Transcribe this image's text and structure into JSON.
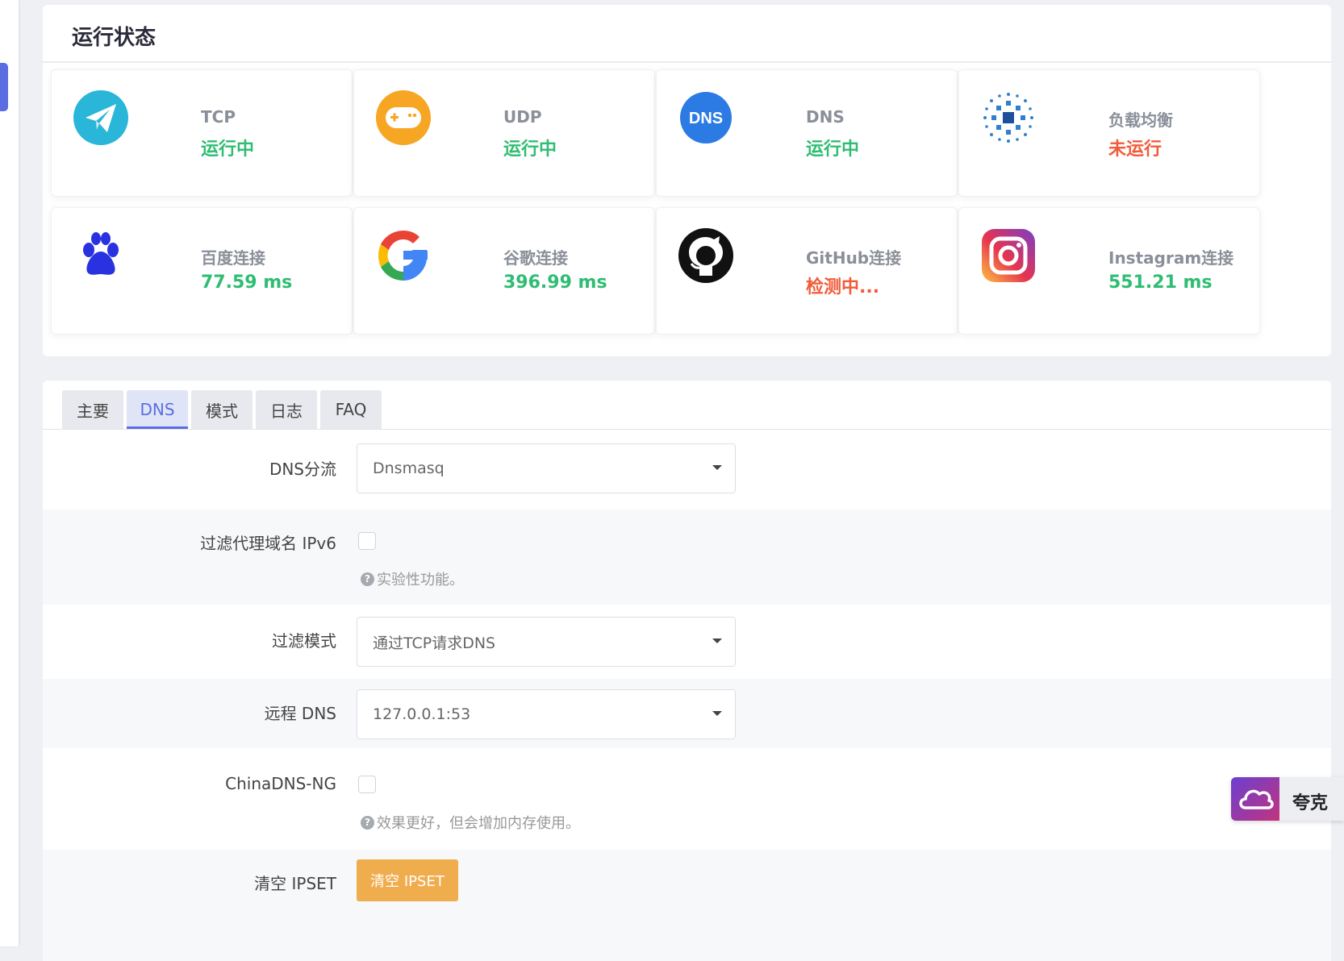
{
  "panel_title": "运行状态",
  "status_cards": [
    {
      "name": "TCP",
      "value": "运行中",
      "state": "ok",
      "icon": "telegram-plane-icon"
    },
    {
      "name": "UDP",
      "value": "运行中",
      "state": "ok",
      "icon": "gamepad-icon"
    },
    {
      "name": "DNS",
      "value": "运行中",
      "state": "ok",
      "icon": "dns-icon",
      "icon_text": "DNS"
    },
    {
      "name": "负载均衡",
      "value": "未运行",
      "state": "bad",
      "icon": "load-balance-icon"
    },
    {
      "name": "百度连接",
      "value": "77.59 ms",
      "state": "ok",
      "icon": "baidu-paw-icon"
    },
    {
      "name": "谷歌连接",
      "value": "396.99 ms",
      "state": "ok",
      "icon": "google-icon"
    },
    {
      "name": "GitHub连接",
      "value": "检测中...",
      "state": "bad",
      "icon": "github-icon"
    },
    {
      "name": "Instagram连接",
      "value": "551.21 ms",
      "state": "ok",
      "icon": "instagram-icon"
    }
  ],
  "tabs": [
    {
      "label": "主要",
      "active": false
    },
    {
      "label": "DNS",
      "active": true
    },
    {
      "label": "模式",
      "active": false
    },
    {
      "label": "日志",
      "active": false
    },
    {
      "label": "FAQ",
      "active": false
    }
  ],
  "fields": {
    "dns_shunt": {
      "label": "DNS分流",
      "value": "Dnsmasq"
    },
    "filter_ipv6": {
      "label": "过滤代理域名 IPv6",
      "checked": false,
      "hint": "实验性功能。"
    },
    "filter_mode": {
      "label": "过滤模式",
      "value": "通过TCP请求DNS"
    },
    "remote_dns": {
      "label": "远程 DNS",
      "value": "127.0.0.1:53"
    },
    "chinadns_ng": {
      "label": "ChinaDNS-NG",
      "checked": false,
      "hint": "效果更好，但会增加内存使用。"
    },
    "clear_ipset": {
      "label": "清空 IPSET",
      "button": "清空 IPSET"
    }
  },
  "float_widget": {
    "text": "夸克"
  },
  "colors": {
    "ok": "#2fbd73",
    "bad": "#f25b3a",
    "accent": "#5b6ee1",
    "button": "#f0ad4e"
  }
}
